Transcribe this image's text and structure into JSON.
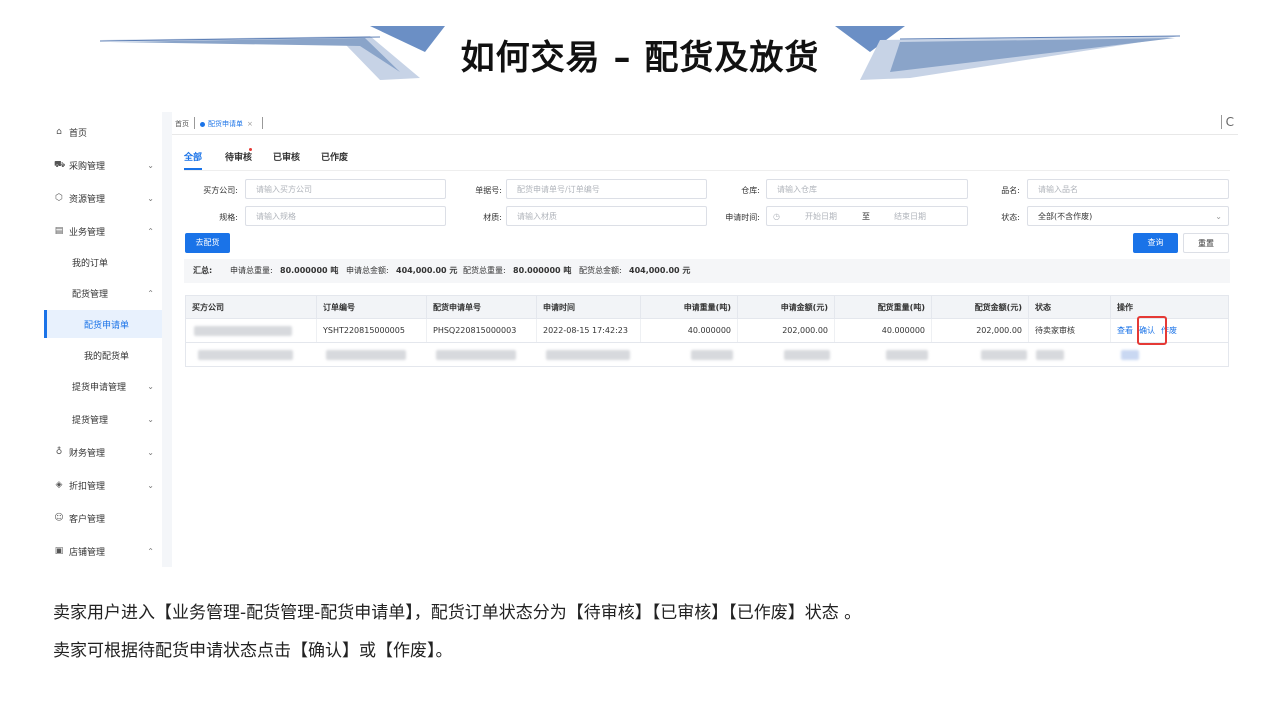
{
  "slide": {
    "title": "如何交易 – 配货及放货",
    "captions": [
      "卖家用户进入【业务管理-配货管理-配货申请单】，配货订单状态分为【待审核】【已审核】【已作废】状态 。",
      "卖家可根据待配货申请状态点击【确认】或【作废】。"
    ]
  },
  "sidebar": {
    "items": [
      {
        "label": "首页",
        "icon": "home-icon"
      },
      {
        "label": "采购管理",
        "icon": "truck-icon"
      },
      {
        "label": "资源管理",
        "icon": "cube-icon"
      },
      {
        "label": "业务管理",
        "icon": "document-icon"
      },
      {
        "label": "我的订单"
      },
      {
        "label": "配货管理"
      },
      {
        "label": "配货申请单"
      },
      {
        "label": "我的配货单"
      },
      {
        "label": "提货申请管理"
      },
      {
        "label": "提货管理"
      },
      {
        "label": "财务管理",
        "icon": "finance-icon"
      },
      {
        "label": "折扣管理",
        "icon": "tag-icon"
      },
      {
        "label": "客户管理",
        "icon": "user-icon"
      },
      {
        "label": "店铺管理",
        "icon": "store-icon"
      }
    ]
  },
  "tabbar": {
    "home": "首页",
    "current": "配货申请单",
    "close": "×",
    "refresh": "C"
  },
  "status_tabs": [
    "全部",
    "待审核",
    "已审核",
    "已作废"
  ],
  "filters": {
    "buyer": {
      "label": "买方公司:",
      "placeholder": "请输入买方公司"
    },
    "doc_no": {
      "label": "单据号:",
      "placeholder": "配货申请单号/订单编号"
    },
    "warehouse": {
      "label": "仓库:",
      "placeholder": "请输入仓库"
    },
    "product": {
      "label": "品名:",
      "placeholder": "请输入品名"
    },
    "spec": {
      "label": "规格:",
      "placeholder": "请输入规格"
    },
    "material": {
      "label": "材质:",
      "placeholder": "请输入材质"
    },
    "apply_time": {
      "label": "申请时间:",
      "start": "开始日期",
      "to": "至",
      "end": "结束日期"
    },
    "status": {
      "label": "状态:",
      "value": "全部(不含作废)"
    }
  },
  "buttons": {
    "go_allocate": "去配货",
    "search": "查询",
    "reset": "重置"
  },
  "summary": {
    "label": "汇总:",
    "apply_weight_label": "申请总重量:",
    "apply_weight": "80.000000 吨",
    "apply_amount_label": "申请总金额:",
    "apply_amount": "404,000.00 元",
    "alloc_weight_label": "配货总重量:",
    "alloc_weight": "80.000000 吨",
    "alloc_amount_label": "配货总金额:",
    "alloc_amount": "404,000.00 元"
  },
  "table": {
    "headers": [
      "买方公司",
      "订单编号",
      "配货申请单号",
      "申请时间",
      "申请重量(吨)",
      "申请金额(元)",
      "配货重量(吨)",
      "配货金额(元)",
      "状态",
      "操作"
    ],
    "row1": {
      "order_no": "YSHT220815000005",
      "apply_no": "PHSQ220815000003",
      "apply_time": "2022-08-15 17:42:23",
      "apply_weight": "40.000000",
      "apply_amount": "202,000.00",
      "alloc_weight": "40.000000",
      "alloc_amount": "202,000.00",
      "status": "待卖家审核",
      "actions": [
        "查看",
        "确认",
        "作废"
      ]
    }
  },
  "colors": {
    "accent": "#1a73e8",
    "highlight": "#e53935"
  }
}
